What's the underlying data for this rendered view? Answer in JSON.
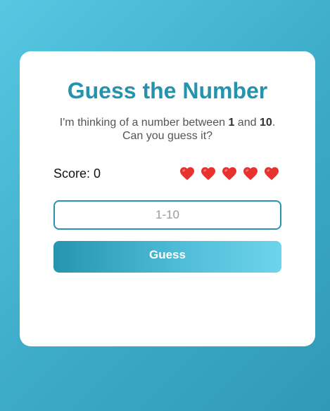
{
  "game": {
    "title": "Guess the Number",
    "intro_prefix": "I'm thinking of a number between ",
    "range_min": "1",
    "intro_and": " and ",
    "range_max": "10",
    "intro_suffix": ".",
    "intro_line2": "Can you guess it?",
    "score_label": "Score: 0",
    "score": 0,
    "lives": 5,
    "heart_icon": "heart-icon",
    "heart_color": "#e8322e"
  },
  "input": {
    "placeholder": "1-10",
    "value": ""
  },
  "guess_button": {
    "label": "Guess"
  },
  "colors": {
    "accent": "#2494ae",
    "background_start": "#56c8e2",
    "background_end": "#2f9ab7"
  }
}
